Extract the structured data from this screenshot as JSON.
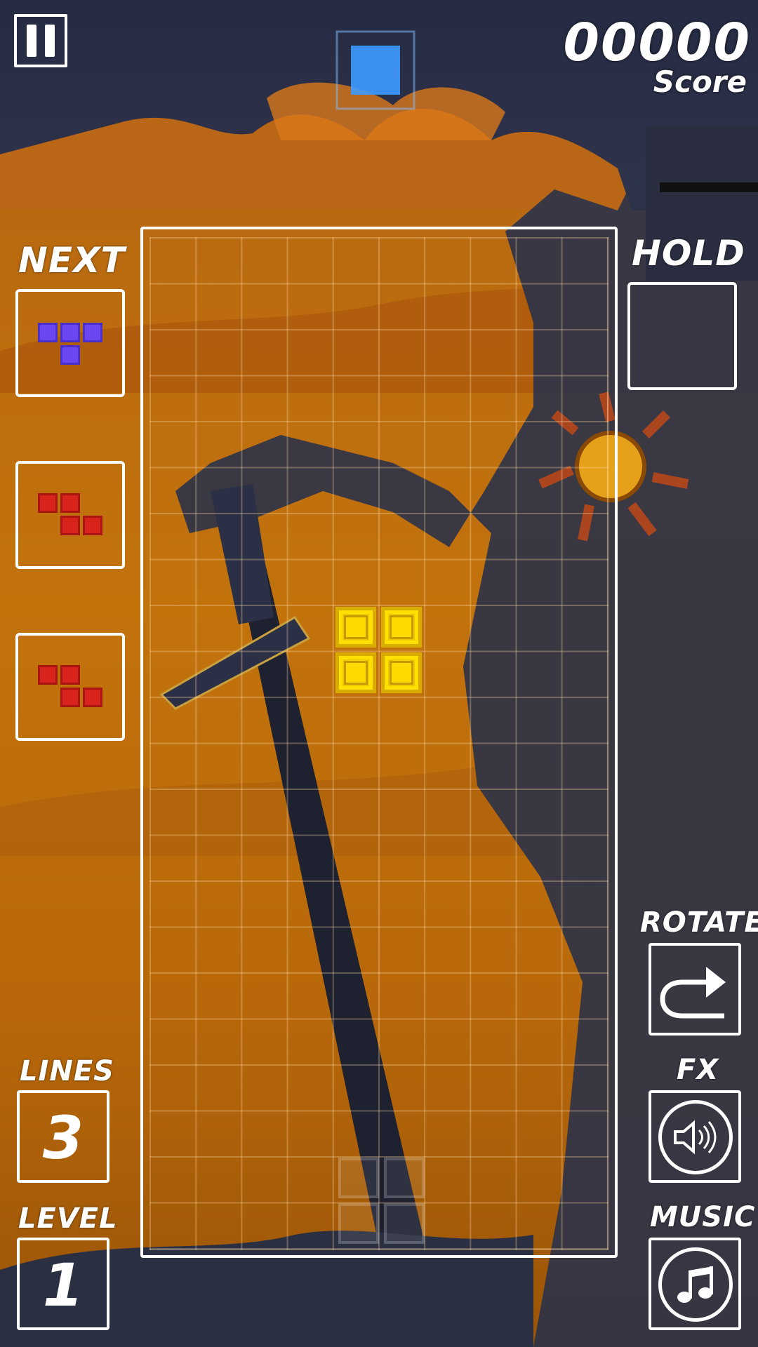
{
  "score": {
    "value": "00000",
    "label": "Score"
  },
  "labels": {
    "next": "NEXT",
    "hold": "HOLD",
    "rotate": "ROTATE",
    "fx": "FX",
    "music": "MUSIC",
    "lines": "LINES",
    "level": "LEVEL"
  },
  "stats": {
    "lines": "3",
    "level": "1"
  },
  "next_queue": [
    "T",
    "Z",
    "Z"
  ],
  "hold_piece": "",
  "active_piece": {
    "type": "O",
    "color": "#f2c800"
  },
  "colors": {
    "board_border": "#ffffff",
    "t_piece": "#6a47f0",
    "z_piece": "#d8241c",
    "o_piece": "#f2c800"
  },
  "icons": {
    "pause": "pause-icon",
    "rotate": "rotate-arrow-icon",
    "fx": "speaker-icon",
    "music": "music-note-icon"
  }
}
